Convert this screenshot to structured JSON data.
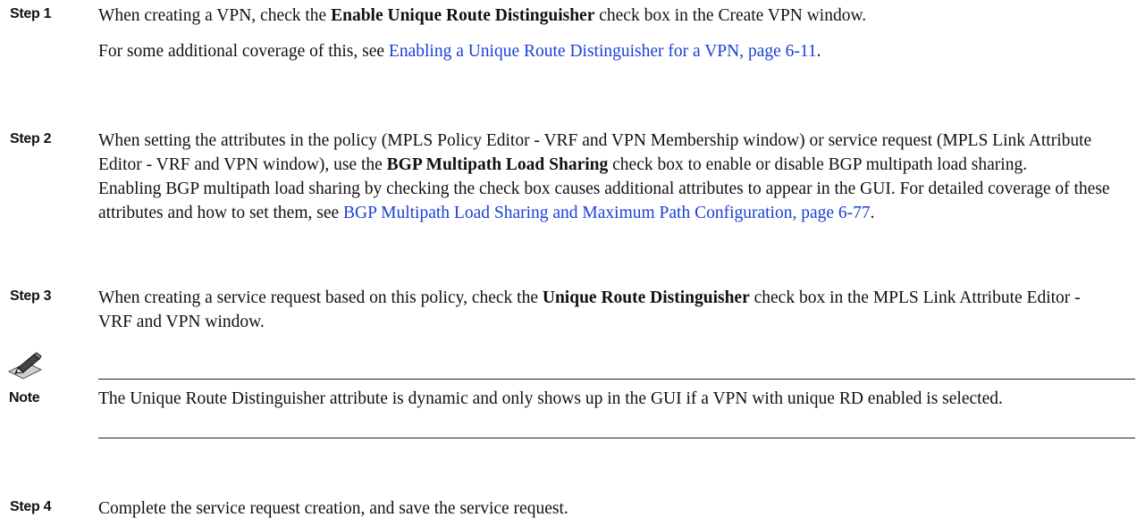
{
  "steps": [
    {
      "label": "Step 1",
      "lines": [
        {
          "parts": [
            {
              "text": "When creating a VPN, check the "
            },
            {
              "text": "Enable Unique Route Distinguisher",
              "bold": true
            },
            {
              "text": " check box in the Create VPN window."
            }
          ]
        },
        {
          "parts": [
            {
              "text": "For some additional coverage of this, see "
            },
            {
              "text": "Enabling a Unique Route Distinguisher for a VPN, page 6-11",
              "link": true
            },
            {
              "text": "."
            }
          ]
        }
      ]
    },
    {
      "label": "Step 2",
      "lines": [
        {
          "parts": [
            {
              "text": "When setting the attributes in the policy (MPLS Policy Editor - VRF and VPN Membership window) or service request (MPLS Link Attribute Editor - VRF and VPN window), use the "
            },
            {
              "text": "BGP Multipath Load Sharing",
              "bold": true
            },
            {
              "text": " check box to enable or disable BGP multipath load sharing."
            }
          ]
        },
        {
          "parts": [
            {
              "text": "Enabling BGP multipath load sharing by checking the check box causes additional attributes to appear in the GUI. For detailed coverage of these attributes and how to set them, see "
            },
            {
              "text": "BGP Multipath Load Sharing and Maximum Path Configuration, page 6-77",
              "link": true
            },
            {
              "text": "."
            }
          ]
        }
      ]
    },
    {
      "label": "Step 3",
      "lines": [
        {
          "parts": [
            {
              "text": "When creating a service request based on this policy, check the "
            },
            {
              "text": "Unique Route Distinguisher",
              "bold": true
            },
            {
              "text": " check box in the MPLS Link Attribute Editor - VRF and VPN window."
            }
          ]
        }
      ]
    },
    {
      "label": "Step 4",
      "lines": [
        {
          "parts": [
            {
              "text": "Complete the service request creation, and save the service request."
            }
          ]
        }
      ]
    }
  ],
  "note": {
    "icon": "pencil-note-icon",
    "label": "Note",
    "text": "The Unique Route Distinguisher attribute is dynamic and only shows up in the GUI if a VPN with unique RD enabled is selected."
  },
  "colors": {
    "link": "#1a3fd6",
    "text": "#111111"
  }
}
